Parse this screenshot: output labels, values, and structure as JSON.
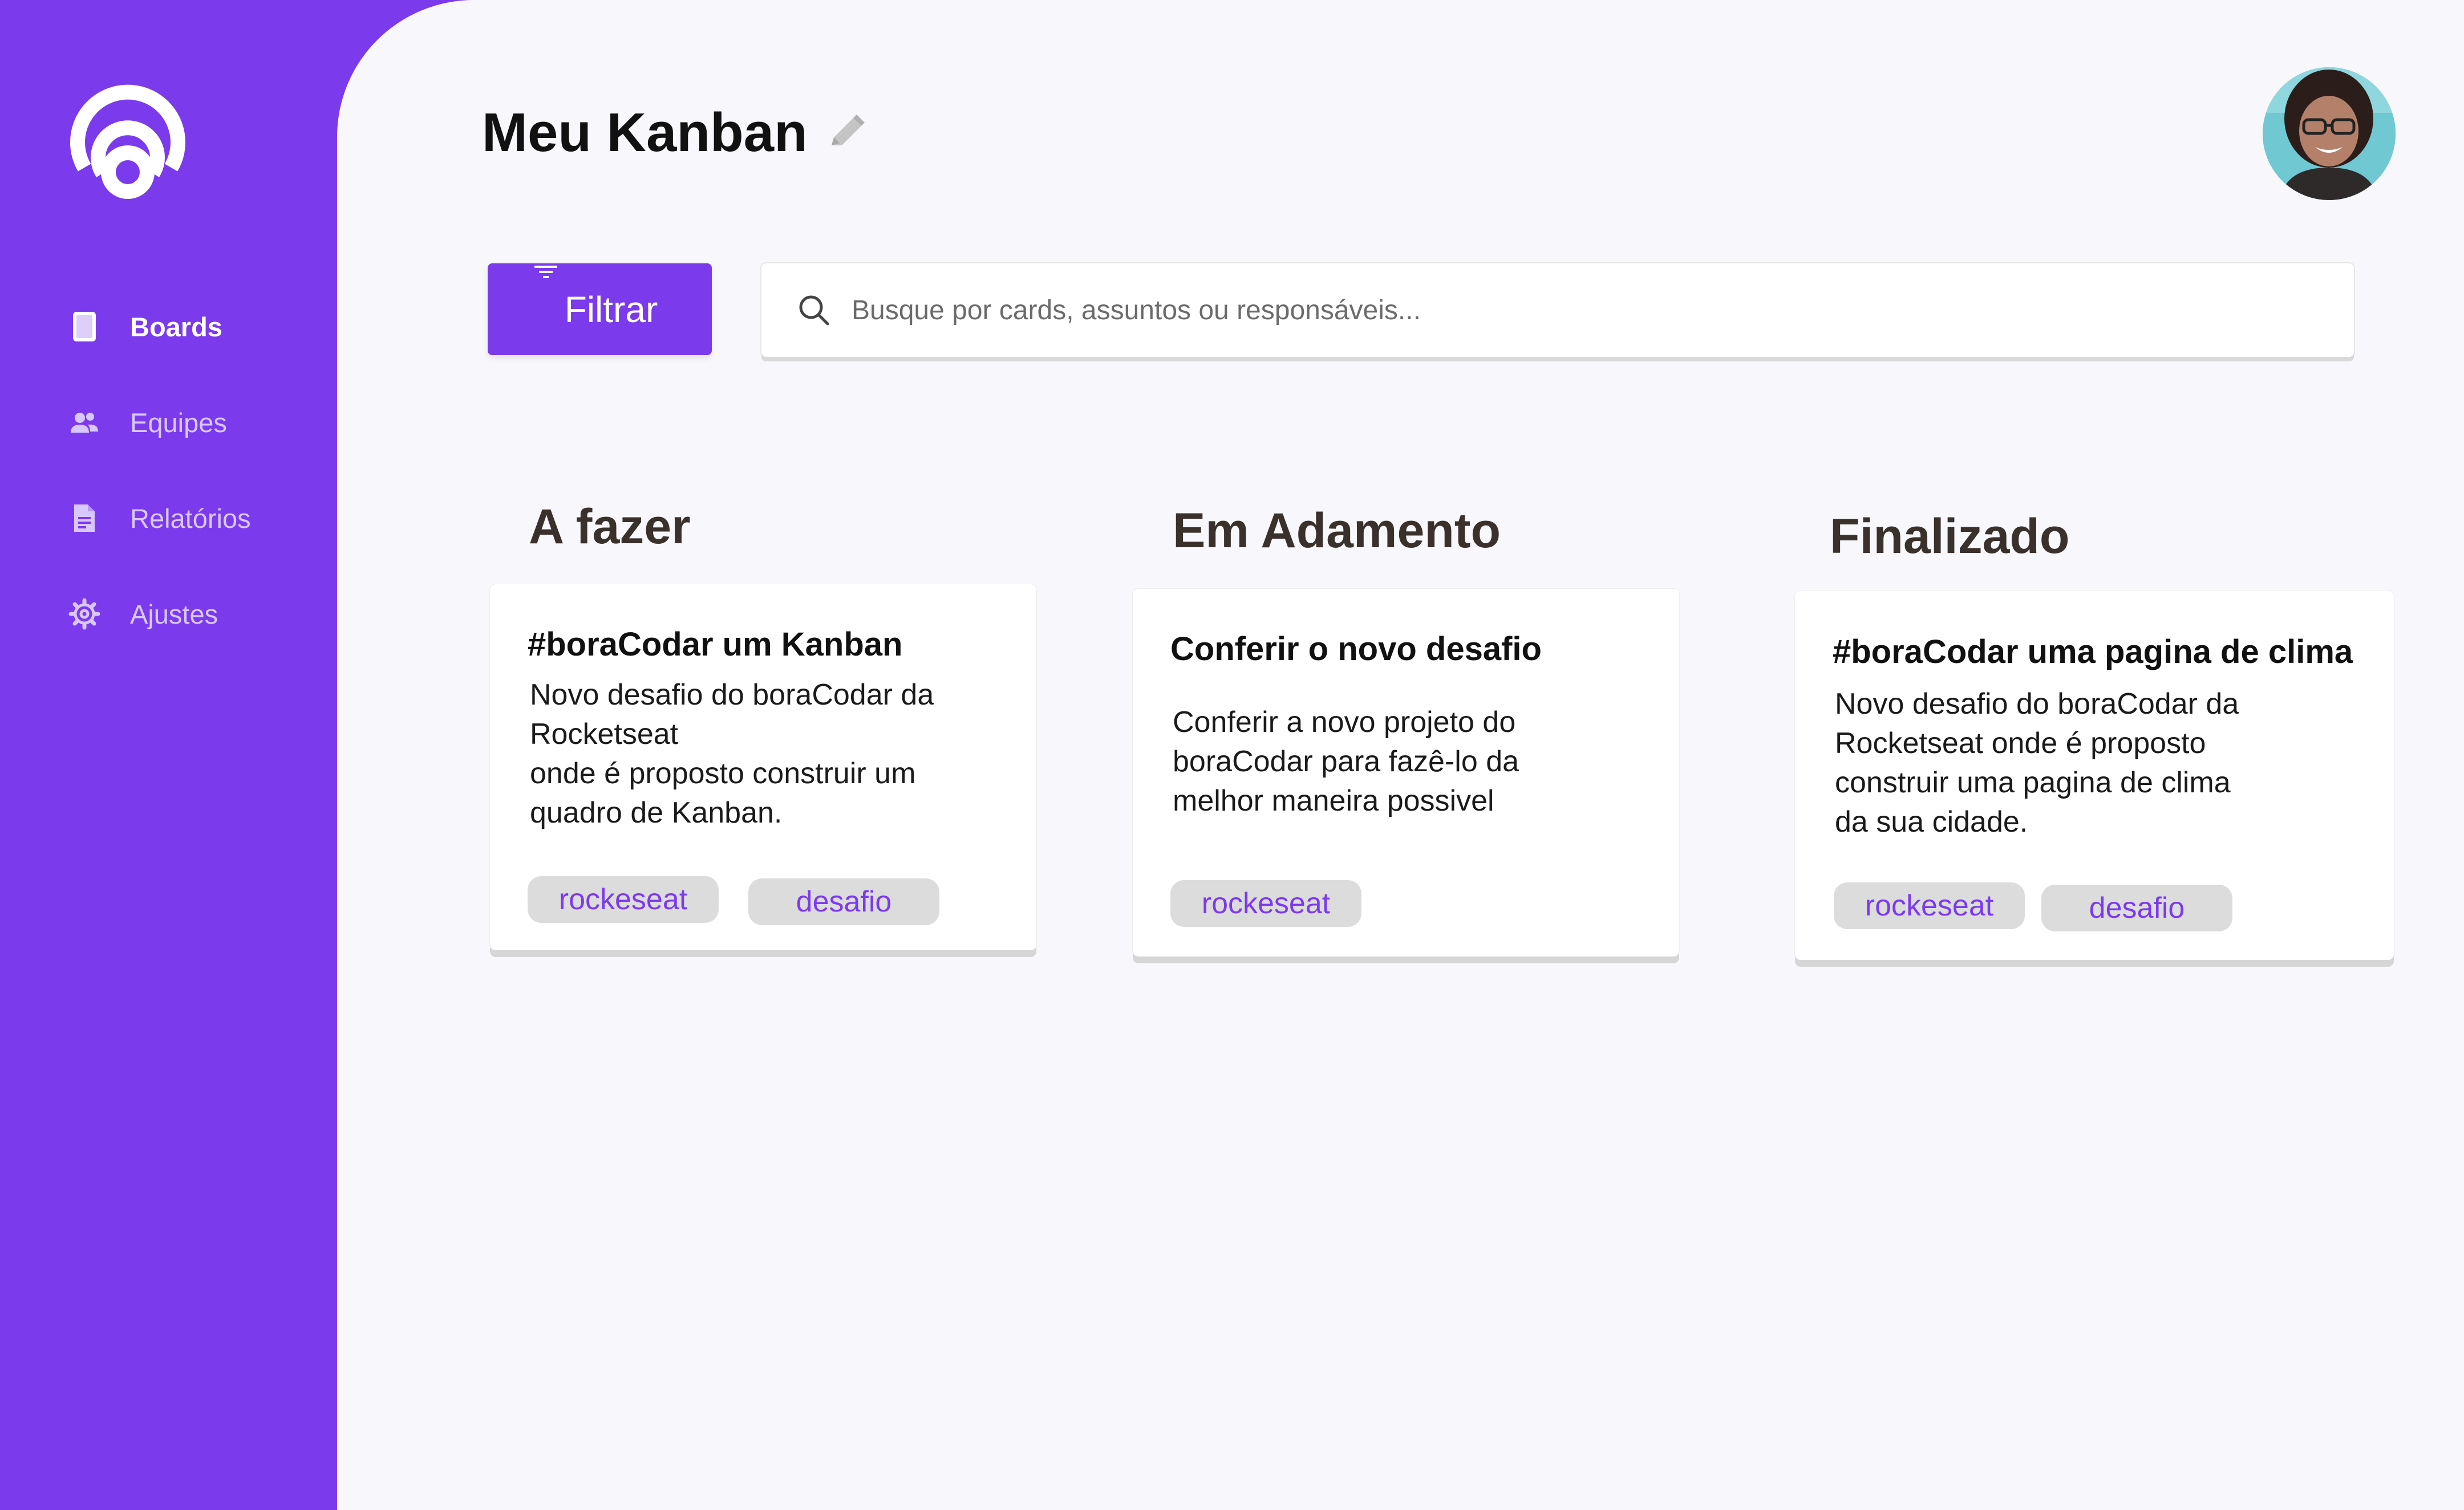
{
  "sidebar": {
    "logo": "rocketseat-logo",
    "items": [
      {
        "label": "Boards",
        "icon": "board-icon",
        "active": true
      },
      {
        "label": "Equipes",
        "icon": "team-icon",
        "active": false
      },
      {
        "label": "Relatórios",
        "icon": "document-icon",
        "active": false
      },
      {
        "label": "Ajustes",
        "icon": "gear-icon",
        "active": false
      }
    ]
  },
  "header": {
    "title": "Meu Kanban",
    "edit_icon": "pencil-icon",
    "avatar": "user-avatar"
  },
  "toolbar": {
    "filter_label": "Filtrar",
    "search_placeholder": "Busque por cards, assuntos ou responsáveis..."
  },
  "columns": [
    {
      "title": "A fazer",
      "cards": [
        {
          "title": "#boraCodar um Kanban",
          "description": "Novo desafio do boraCodar da\nRocketseat\nonde é proposto construir um\nquadro de Kanban.",
          "tags": [
            "rockeseat",
            "desafio"
          ]
        }
      ]
    },
    {
      "title": "Em Adamento",
      "cards": [
        {
          "title": "Conferir o novo desafio",
          "description": "Conferir a novo projeto do\nboraCodar para fazê-lo da\nmelhor maneira possivel",
          "tags": [
            "rockeseat"
          ]
        }
      ]
    },
    {
      "title": "Finalizado",
      "cards": [
        {
          "title": "#boraCodar uma pagina de clima",
          "description": "Novo desafio do boraCodar da\nRocketseat onde é proposto\nconstruir uma pagina de clima\nda sua cidade.",
          "tags": [
            "rockeseat",
            "desafio"
          ]
        }
      ]
    }
  ],
  "colors": {
    "brand": "#7c3aed",
    "background": "#f8f8fc",
    "tag_background": "#dcdcdc"
  }
}
